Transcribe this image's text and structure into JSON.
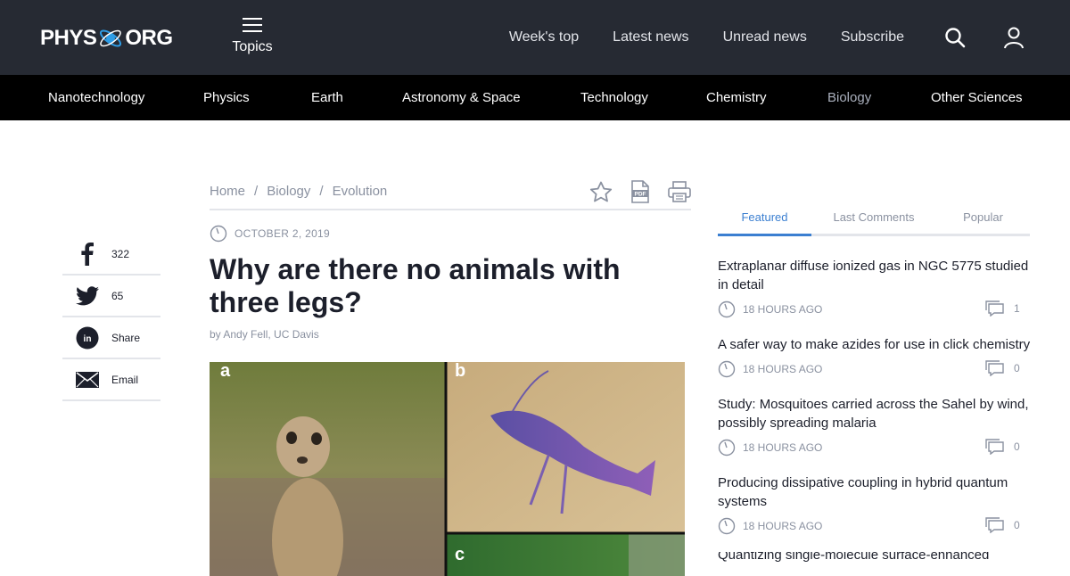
{
  "header": {
    "logo_left": "PHYS",
    "logo_right": "ORG",
    "topics_label": "Topics",
    "nav": [
      "Week's top",
      "Latest news",
      "Unread news",
      "Subscribe"
    ]
  },
  "categories": [
    "Nanotechnology",
    "Physics",
    "Earth",
    "Astronomy & Space",
    "Technology",
    "Chemistry",
    "Biology",
    "Other Sciences"
  ],
  "active_category": "Biology",
  "share": [
    {
      "network": "facebook",
      "label": "322"
    },
    {
      "network": "twitter",
      "label": "65"
    },
    {
      "network": "linkedin",
      "label": "Share"
    },
    {
      "network": "email",
      "label": "Email"
    }
  ],
  "breadcrumb": [
    "Home",
    "Biology",
    "Evolution"
  ],
  "article": {
    "date": "OCTOBER 2, 2019",
    "title": "Why are there no animals with three legs?",
    "byline": "by Andy Fell, UC Davis",
    "figure_labels": [
      "a",
      "b",
      "c"
    ]
  },
  "sidebar": {
    "tabs": [
      "Featured",
      "Last Comments",
      "Popular"
    ],
    "active_tab": "Featured",
    "items": [
      {
        "title": "Extraplanar diffuse ionized gas in NGC 5775 studied in detail",
        "time": "18 HOURS AGO",
        "comments": "1"
      },
      {
        "title": "A safer way to make azides for use in click chemistry",
        "time": "18 HOURS AGO",
        "comments": "0"
      },
      {
        "title": "Study: Mosquitoes carried across the Sahel by wind, possibly spreading malaria",
        "time": "18 HOURS AGO",
        "comments": "0"
      },
      {
        "title": "Producing dissipative coupling in hybrid quantum systems",
        "time": "18 HOURS AGO",
        "comments": "0"
      },
      {
        "title": "Quantizing single-molecule surface-enhanced Raman",
        "time": "",
        "comments": ""
      }
    ]
  },
  "colors": {
    "topbar": "#262a33",
    "catbar": "#000000",
    "accent": "#3b7fd1",
    "muted": "#8a91a0"
  }
}
